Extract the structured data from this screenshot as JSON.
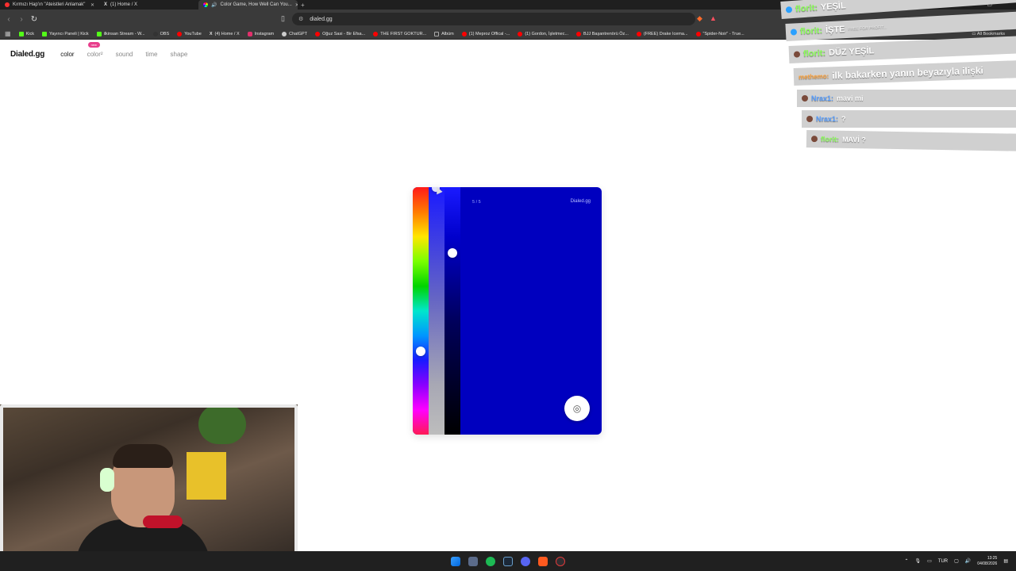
{
  "tabs": [
    {
      "title": "Kırmızı Hap'ın \"Ateistleri Anlamak\"",
      "color": "#ff3030"
    },
    {
      "title": "(1) Home / X",
      "color": "#ffffff"
    },
    {
      "title": "Color Game, How Well Can You...",
      "color": "#e0e0e0",
      "active": true
    }
  ],
  "address": {
    "url": "dialed.gg"
  },
  "bookmarks": [
    {
      "label": "Kick",
      "color": "#53fc18"
    },
    {
      "label": "Yayıncı Paneli | Kick",
      "color": "#53fc18"
    },
    {
      "label": "ilkinsan Stream - W...",
      "color": "#53fc18"
    },
    {
      "label": "OBS",
      "color": "#333333"
    },
    {
      "label": "YouTube",
      "color": "#ff0000"
    },
    {
      "label": "(4) Home / X",
      "color": "#ffffff"
    },
    {
      "label": "Instagram",
      "color": "#e1306c"
    },
    {
      "label": "ChatGPT",
      "color": "#cccccc"
    },
    {
      "label": "Oğuz Sasi - Bir Efsa...",
      "color": "#ff0000"
    },
    {
      "label": "THE FIRST GOKTUR...",
      "color": "#ff0000"
    },
    {
      "label": "Albüm",
      "color": "#aaaaaa"
    },
    {
      "label": "(1) Meproz Offical -...",
      "color": "#ff0000"
    },
    {
      "label": "(1) Gordon, İşletmec...",
      "color": "#ff0000"
    },
    {
      "label": "BJJ Başantrenörü Öz...",
      "color": "#ff0000"
    },
    {
      "label": "(FREE) Drake Icema...",
      "color": "#ff0000"
    },
    {
      "label": "\"Spider-Noir\" - True...",
      "color": "#ff0000"
    }
  ],
  "all_bookmarks": "All Bookmarks",
  "site": {
    "logo": "Dialed.gg",
    "nav": [
      {
        "label": "color",
        "active": true
      },
      {
        "label": "color²",
        "badge": "new"
      },
      {
        "label": "sound"
      },
      {
        "label": "time"
      },
      {
        "label": "shape"
      }
    ]
  },
  "game": {
    "progress": "5 / 5",
    "brand": "Dialed.gg",
    "target_color": "#0000bf",
    "hue_handle": "#ffffff",
    "submit_icon": "fingerprint-icon"
  },
  "chat": [
    {
      "user": "florit:",
      "message": "YEŞİL",
      "user_color": "#8cff5a"
    },
    {
      "user": "florit:",
      "message": "İŞTE",
      "user_color": "#8cff5a",
      "dim": "FREE FOR PROFIT..."
    },
    {
      "user": "florit:",
      "message": "DÜZ YEŞİL",
      "user_color": "#8cff5a"
    },
    {
      "user": "methemo:",
      "message": "ilk bakarken yanın beyazıyla ilişki",
      "user_color": "#ffa23a"
    },
    {
      "user": "Nrax1:",
      "message": "mavi mi",
      "user_color": "#5aa0ff"
    },
    {
      "user": "Nrax1:",
      "message": "?",
      "user_color": "#5aa0ff"
    },
    {
      "user": "florit:",
      "message": "MAVİ ?",
      "user_color": "#8cff5a"
    }
  ],
  "taskbar": {
    "language": "TUR",
    "time": "13:25",
    "date": "04/08/2026"
  }
}
